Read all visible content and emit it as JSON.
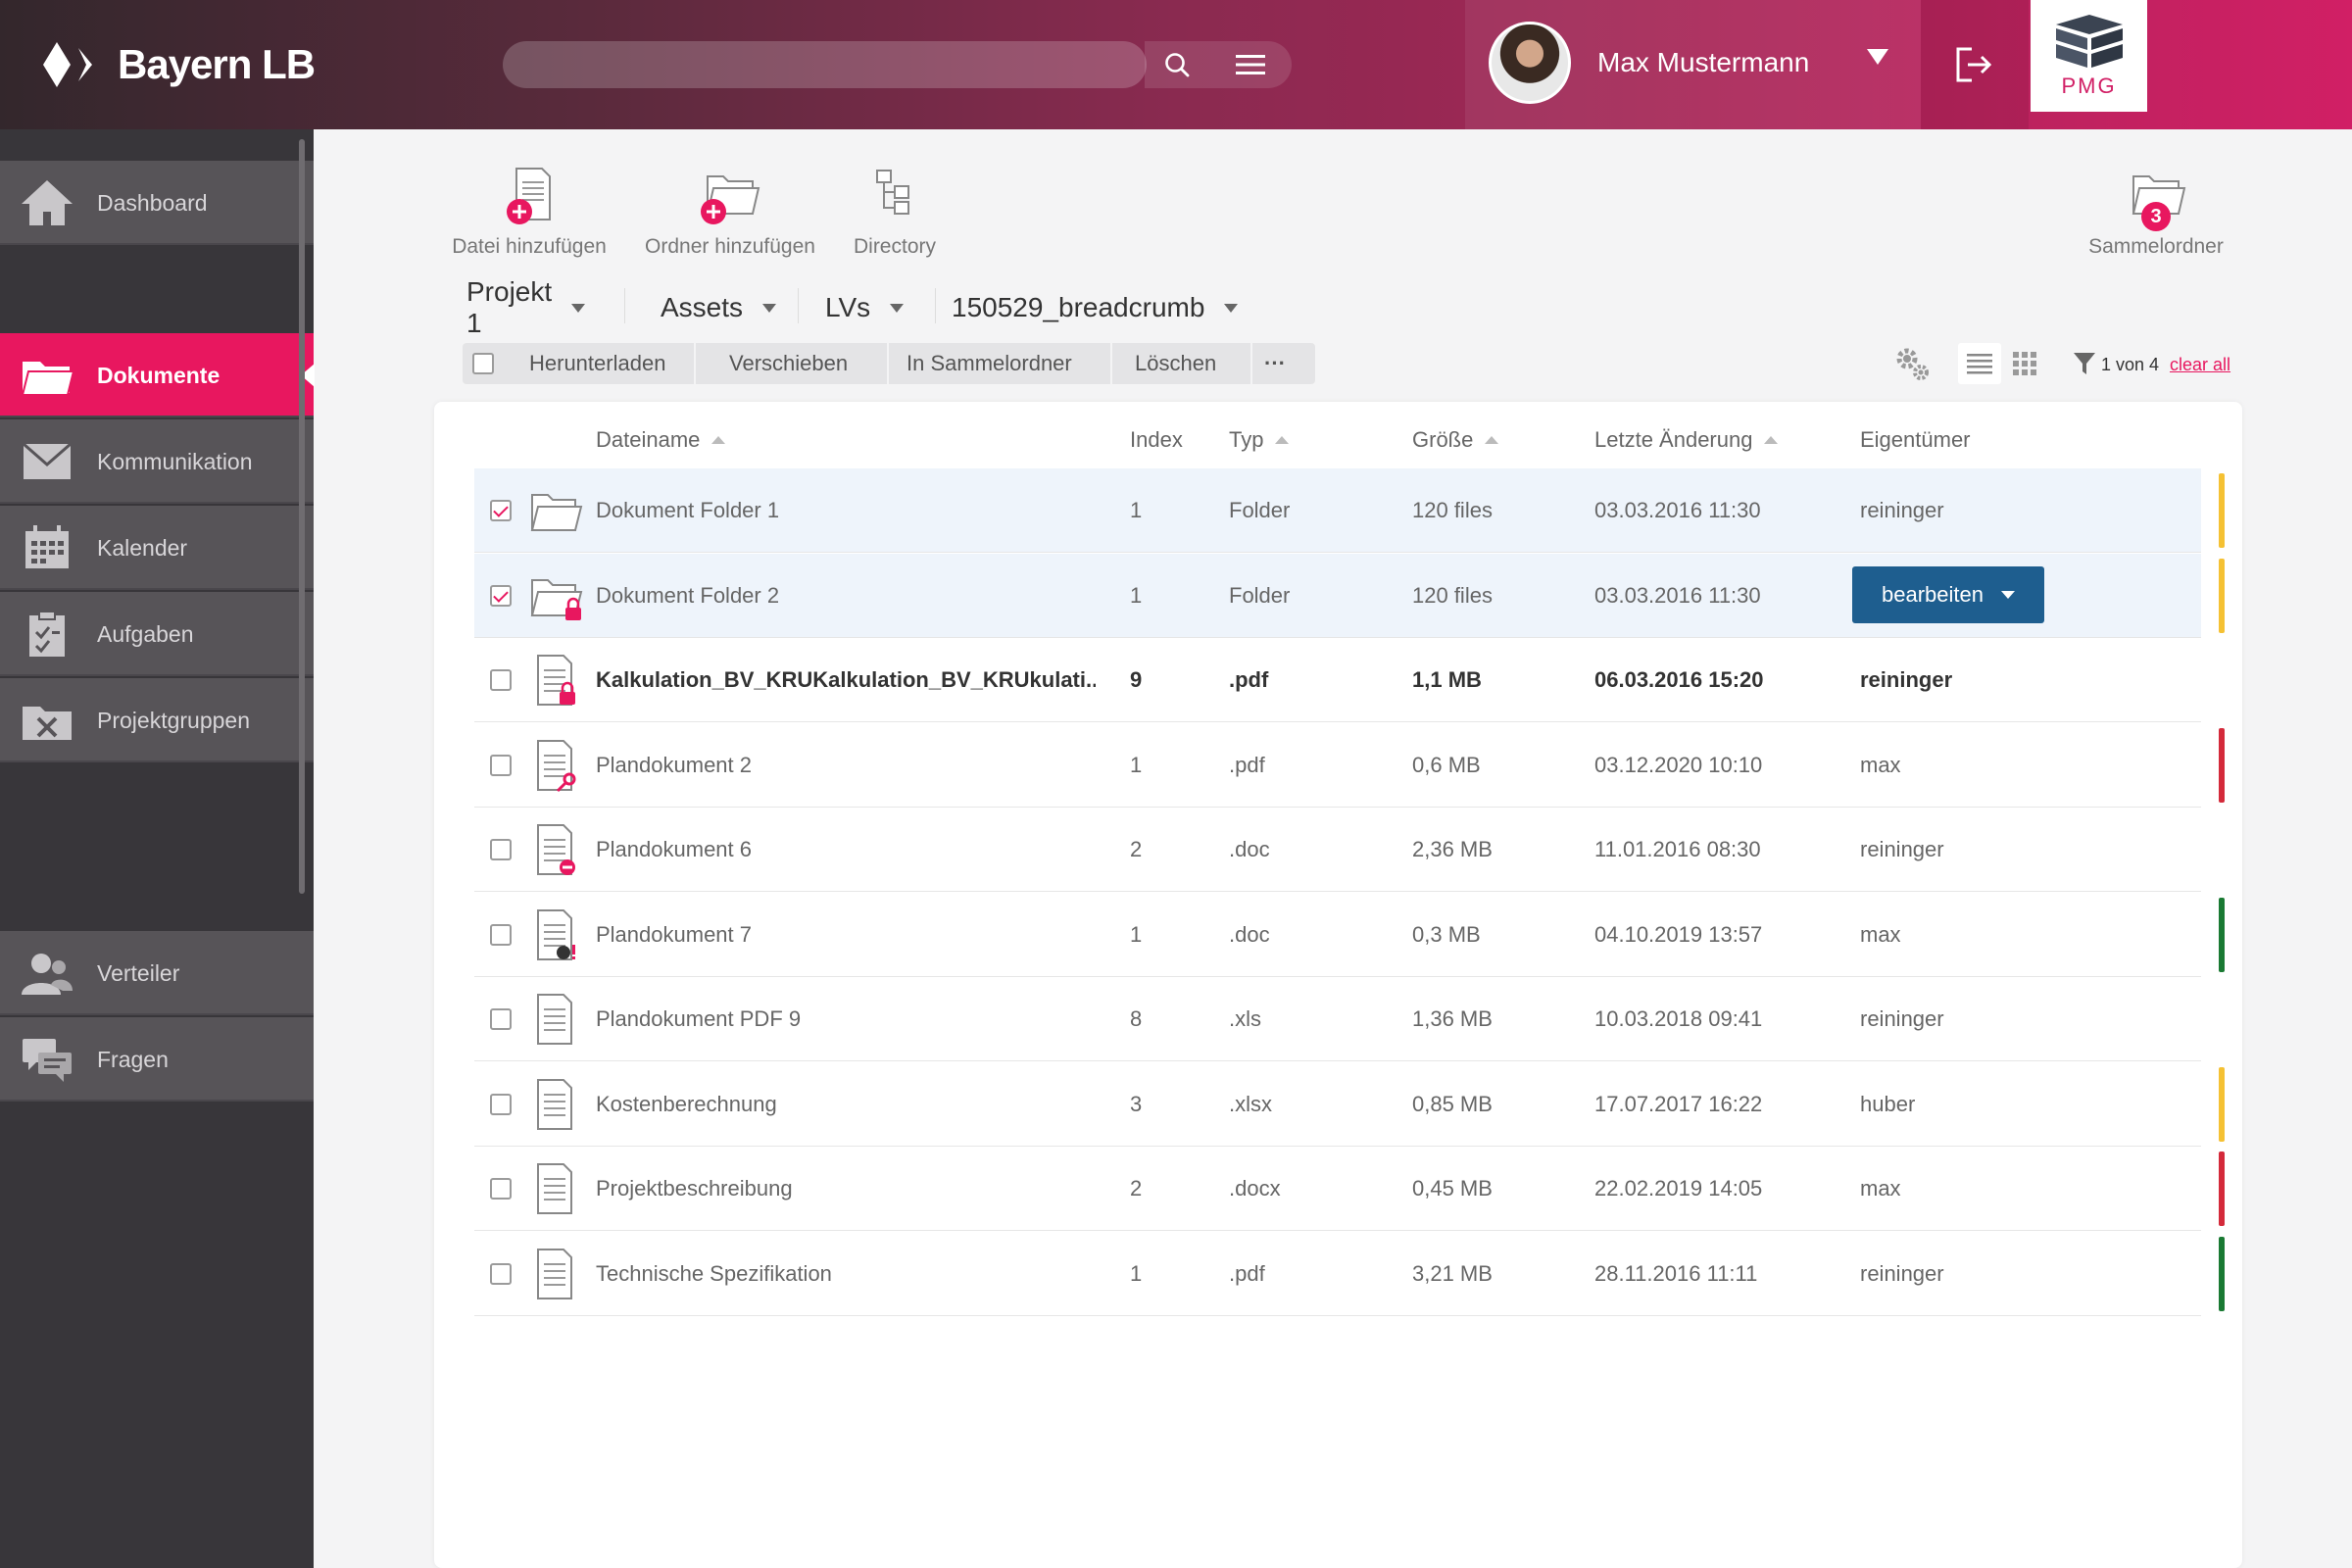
{
  "header": {
    "brand": "Bayern LB",
    "search": {
      "value": "",
      "placeholder": ""
    },
    "user_name": "Max Mustermann",
    "partner_logo": "PMG"
  },
  "sidebar": {
    "items": [
      {
        "label": "Dashboard",
        "icon": "home-icon",
        "active": false
      },
      {
        "label": "Dokumente",
        "icon": "folder-icon",
        "active": true
      },
      {
        "label": "Kommunikation",
        "icon": "mail-icon",
        "active": false
      },
      {
        "label": "Kalender",
        "icon": "calendar-icon",
        "active": false
      },
      {
        "label": "Aufgaben",
        "icon": "clipboard-icon",
        "active": false
      },
      {
        "label": "Projektgruppen",
        "icon": "folder-tools-icon",
        "active": false
      },
      {
        "label": "Verteiler",
        "icon": "users-icon",
        "active": false
      },
      {
        "label": "Fragen",
        "icon": "chat-icon",
        "active": false
      }
    ]
  },
  "toolbar": {
    "add_file": "Datei hinzufügen",
    "add_folder": "Ordner hinzufügen",
    "directory": "Directory",
    "collection": "Sammelordner",
    "collection_count": "3"
  },
  "breadcrumb": [
    "Projekt 1",
    "Assets",
    "LVs",
    "150529_breadcrumb"
  ],
  "actions": {
    "download": "Herunterladen",
    "move": "Verschieben",
    "to_collection": "In Sammelordner",
    "delete": "Löschen",
    "more": "···"
  },
  "filter": {
    "count": "1 von 4",
    "clear": "clear all"
  },
  "table": {
    "columns": {
      "name": "Dateiname",
      "index": "Index",
      "type": "Typ",
      "size": "Größe",
      "modified": "Letzte Änderung",
      "owner": "Eigentümer"
    },
    "edit_button": "bearbeiten",
    "rows": [
      {
        "name": "Dokument Folder 1",
        "index": "1",
        "type": "Folder",
        "size": "120 files",
        "modified": "03.03.2016 11:30",
        "owner": "reininger",
        "checked": true,
        "kind": "folder",
        "flag": "#f5c133"
      },
      {
        "name": "Dokument Folder 2",
        "index": "1",
        "type": "Folder",
        "size": "120 files",
        "modified": "03.03.2016 11:30",
        "owner": "",
        "checked": true,
        "kind": "folder-lock",
        "flag": "#f5c133"
      },
      {
        "name": "Kalkulation_BV_KRUKalkulation_BV_KRUkulati...",
        "index": "9",
        "type": ".pdf",
        "size": "1,1 MB",
        "modified": "06.03.2016 15:20",
        "owner": "reininger",
        "checked": false,
        "kind": "doc-lock",
        "flag": ""
      },
      {
        "name": "Plandokument 2",
        "index": "1",
        "type": ".pdf",
        "size": "0,6 MB",
        "modified": "03.12.2020 10:10",
        "owner": "max",
        "checked": false,
        "kind": "doc-key",
        "flag": "#d42a3a"
      },
      {
        "name": "Plandokument 6",
        "index": "2",
        "type": ".doc",
        "size": "2,36 MB",
        "modified": "11.01.2016 08:30",
        "owner": "reininger",
        "checked": false,
        "kind": "doc-minus",
        "flag": ""
      },
      {
        "name": "Plandokument 7",
        "index": "1",
        "type": ".doc",
        "size": "0,3 MB",
        "modified": "04.10.2019 13:57",
        "owner": "max",
        "checked": false,
        "kind": "doc-alert",
        "flag": "#1a7a33"
      },
      {
        "name": "Plandokument PDF 9",
        "index": "8",
        "type": ".xls",
        "size": "1,36 MB",
        "modified": "10.03.2018 09:41",
        "owner": "reininger",
        "checked": false,
        "kind": "doc",
        "flag": ""
      },
      {
        "name": "Kostenberechnung",
        "index": "3",
        "type": ".xlsx",
        "size": "0,85 MB",
        "modified": "17.07.2017 16:22",
        "owner": "huber",
        "checked": false,
        "kind": "doc",
        "flag": "#f5c133"
      },
      {
        "name": "Projektbeschreibung",
        "index": "2",
        "type": ".docx",
        "size": "0,45 MB",
        "modified": "22.02.2019 14:05",
        "owner": "max",
        "checked": false,
        "kind": "doc",
        "flag": "#d42a3a"
      },
      {
        "name": "Technische Spezifikation",
        "index": "1",
        "type": ".pdf",
        "size": "3,21 MB",
        "modified": "28.11.2016 11:11",
        "owner": "reininger",
        "checked": false,
        "kind": "doc",
        "flag": "#1a7a33"
      }
    ]
  }
}
